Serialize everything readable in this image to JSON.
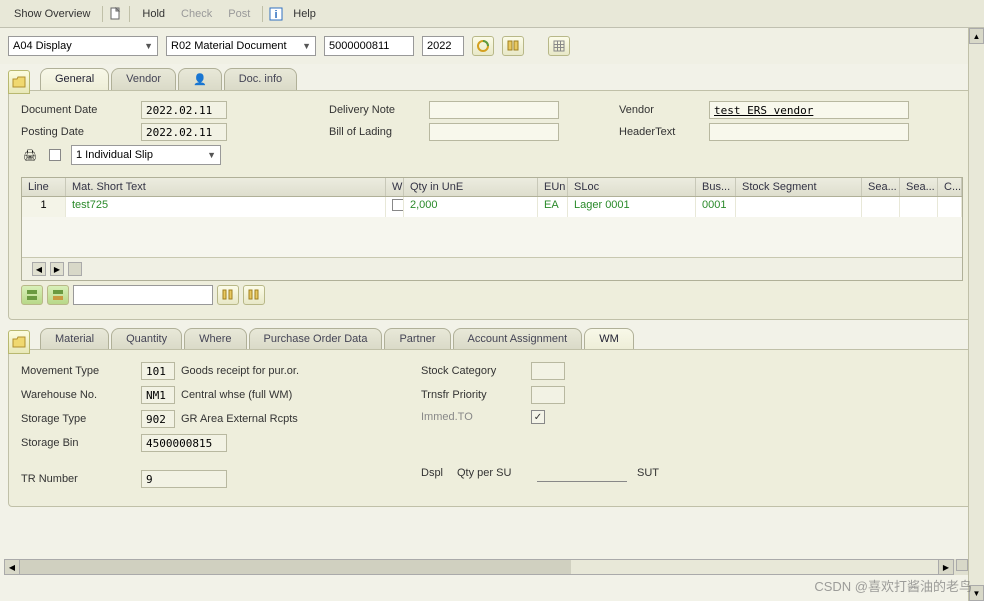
{
  "toolbar": {
    "show_overview": "Show Overview",
    "hold": "Hold",
    "check": "Check",
    "post": "Post",
    "help": "Help"
  },
  "selectors": {
    "mode": "A04 Display",
    "doc_type": "R02 Material Document",
    "doc_number": "5000000811",
    "year": "2022"
  },
  "tabs_top": {
    "general": "General",
    "vendor": "Vendor",
    "doc_info": "Doc. info"
  },
  "general_panel": {
    "doc_date_label": "Document Date",
    "doc_date": "2022.02.11",
    "posting_date_label": "Posting Date",
    "posting_date": "2022.02.11",
    "slip_option": "1 Individual Slip",
    "delivery_note_label": "Delivery Note",
    "delivery_note": "",
    "bill_of_lading_label": "Bill of Lading",
    "bill_of_lading": "",
    "vendor_label": "Vendor",
    "vendor": "test ERS vendor",
    "header_text_label": "HeaderText",
    "header_text": ""
  },
  "table": {
    "headers": {
      "line": "Line",
      "mat": "Mat. Short Text",
      "w": "W",
      "qty": "Qty in UnE",
      "eun": "EUn",
      "sloc": "SLoc",
      "bus": "Bus...",
      "stock_seg": "Stock Segment",
      "sea1": "Sea...",
      "sea2": "Sea...",
      "c": "C..."
    },
    "rows": [
      {
        "line": "1",
        "mat": "test725",
        "qty": "2,000",
        "eun": "EA",
        "sloc": "Lager 0001",
        "bus": "0001",
        "stock_seg": ""
      }
    ]
  },
  "tabs_bottom": {
    "material": "Material",
    "quantity": "Quantity",
    "where": "Where",
    "po_data": "Purchase Order Data",
    "partner": "Partner",
    "acct": "Account Assignment",
    "wm": "WM"
  },
  "wm_panel": {
    "movement_type_label": "Movement Type",
    "movement_type": "101",
    "movement_type_desc": "Goods receipt for pur.or.",
    "warehouse_label": "Warehouse No.",
    "warehouse": "NM1",
    "warehouse_desc": "Central whse (full WM)",
    "storage_type_label": "Storage Type",
    "storage_type": "902",
    "storage_type_desc": "GR Area External Rcpts",
    "storage_bin_label": "Storage Bin",
    "storage_bin": "4500000815",
    "tr_number_label": "TR Number",
    "tr_number": "9",
    "stock_cat_label": "Stock Category",
    "trnsfr_label": "Trnsfr Priority",
    "immed_label": "Immed.TO",
    "dspl_label": "Dspl",
    "qty_su_label": "Qty per SU",
    "sut_label": "SUT"
  },
  "watermark": "CSDN @喜欢打酱油的老鸟"
}
